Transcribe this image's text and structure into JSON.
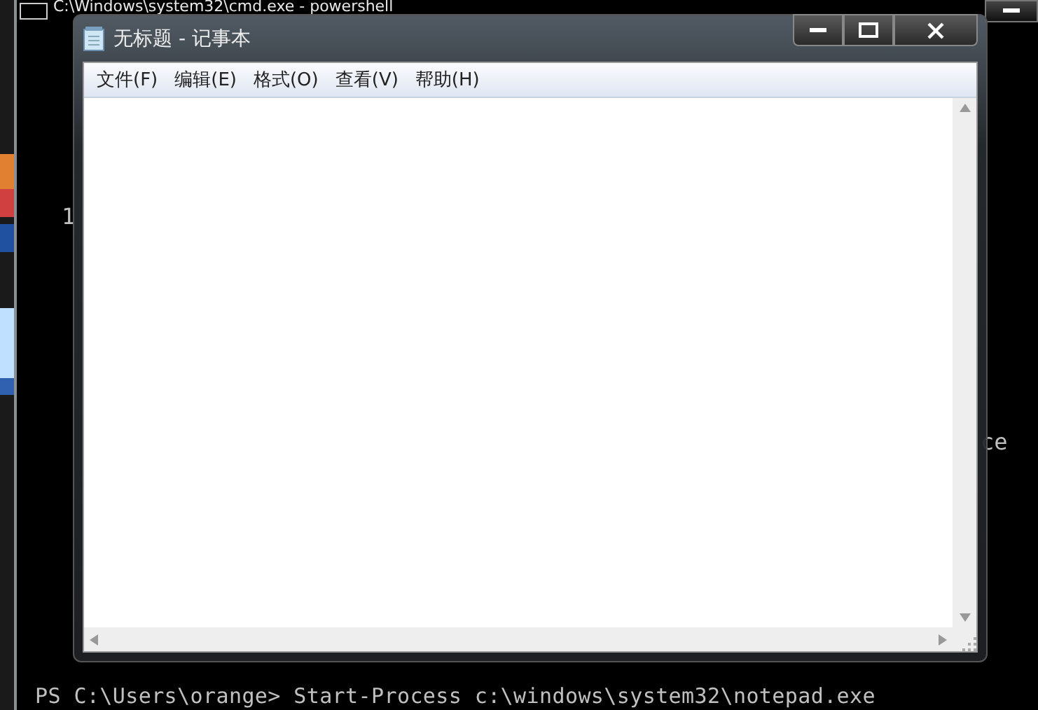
{
  "console_window": {
    "title": "C:\\Windows\\system32\\cmd.exe - powershell",
    "fragments": [
      "1",
      "ce"
    ],
    "prompt": "PS C:\\Users\\orange> Start-Process c:\\windows\\system32\\notepad.exe"
  },
  "notepad": {
    "title": "无标题 - 记事本",
    "menu": [
      "文件(F)",
      "编辑(E)",
      "格式(O)",
      "查看(V)",
      "帮助(H)"
    ]
  }
}
